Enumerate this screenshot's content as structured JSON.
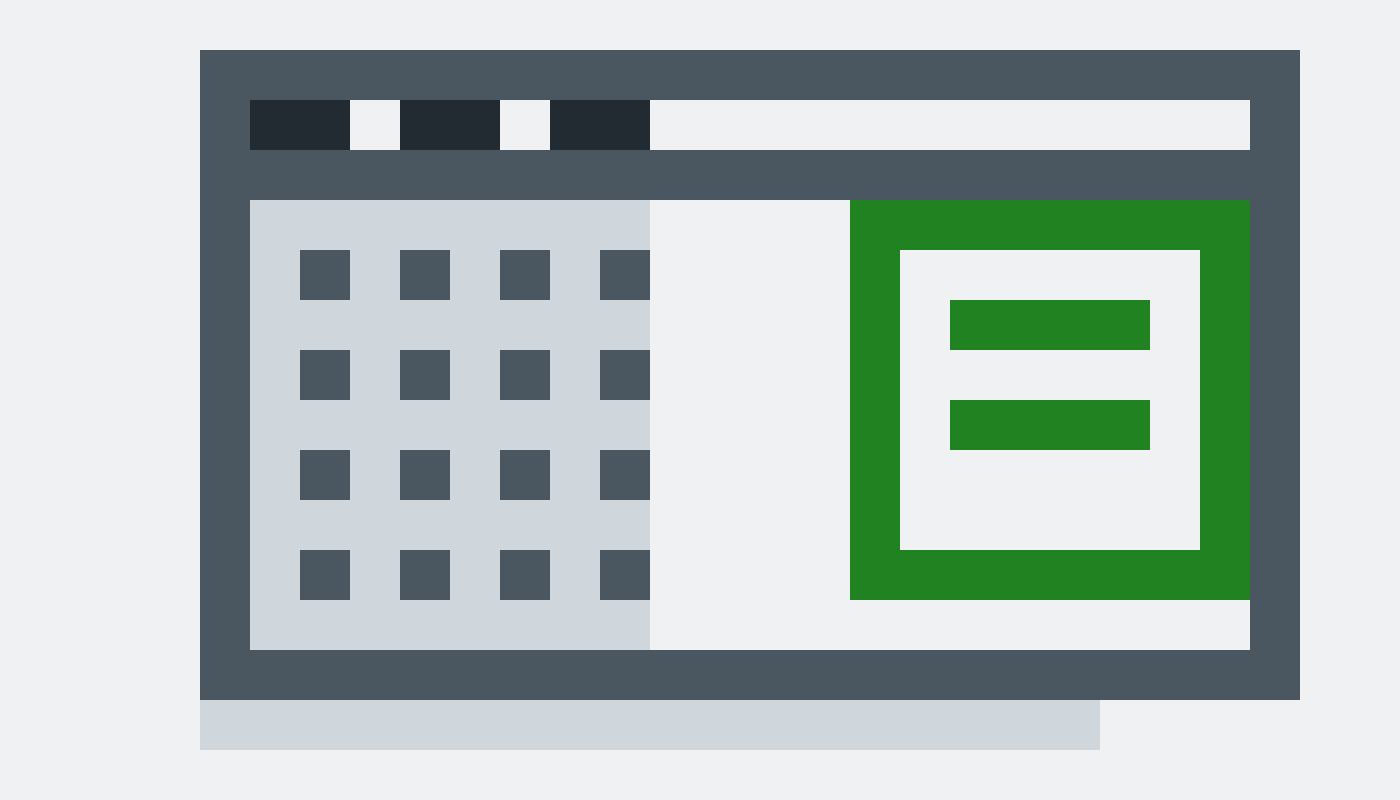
{
  "colors": {
    "background": "#eff1f2",
    "frame": "#4a5660",
    "panel": "#cfd6dc",
    "tab": "#232b32",
    "accent": "#208220"
  },
  "toolbar": {
    "tabs": [
      {
        "icon": "tab-block"
      },
      {
        "icon": "tab-block"
      },
      {
        "icon": "tab-block"
      }
    ]
  },
  "grid": {
    "rows": 4,
    "columns": 4,
    "icon": "square-cell-icon"
  },
  "accent_panel": {
    "icon": "list-document-icon",
    "lines": 2
  }
}
